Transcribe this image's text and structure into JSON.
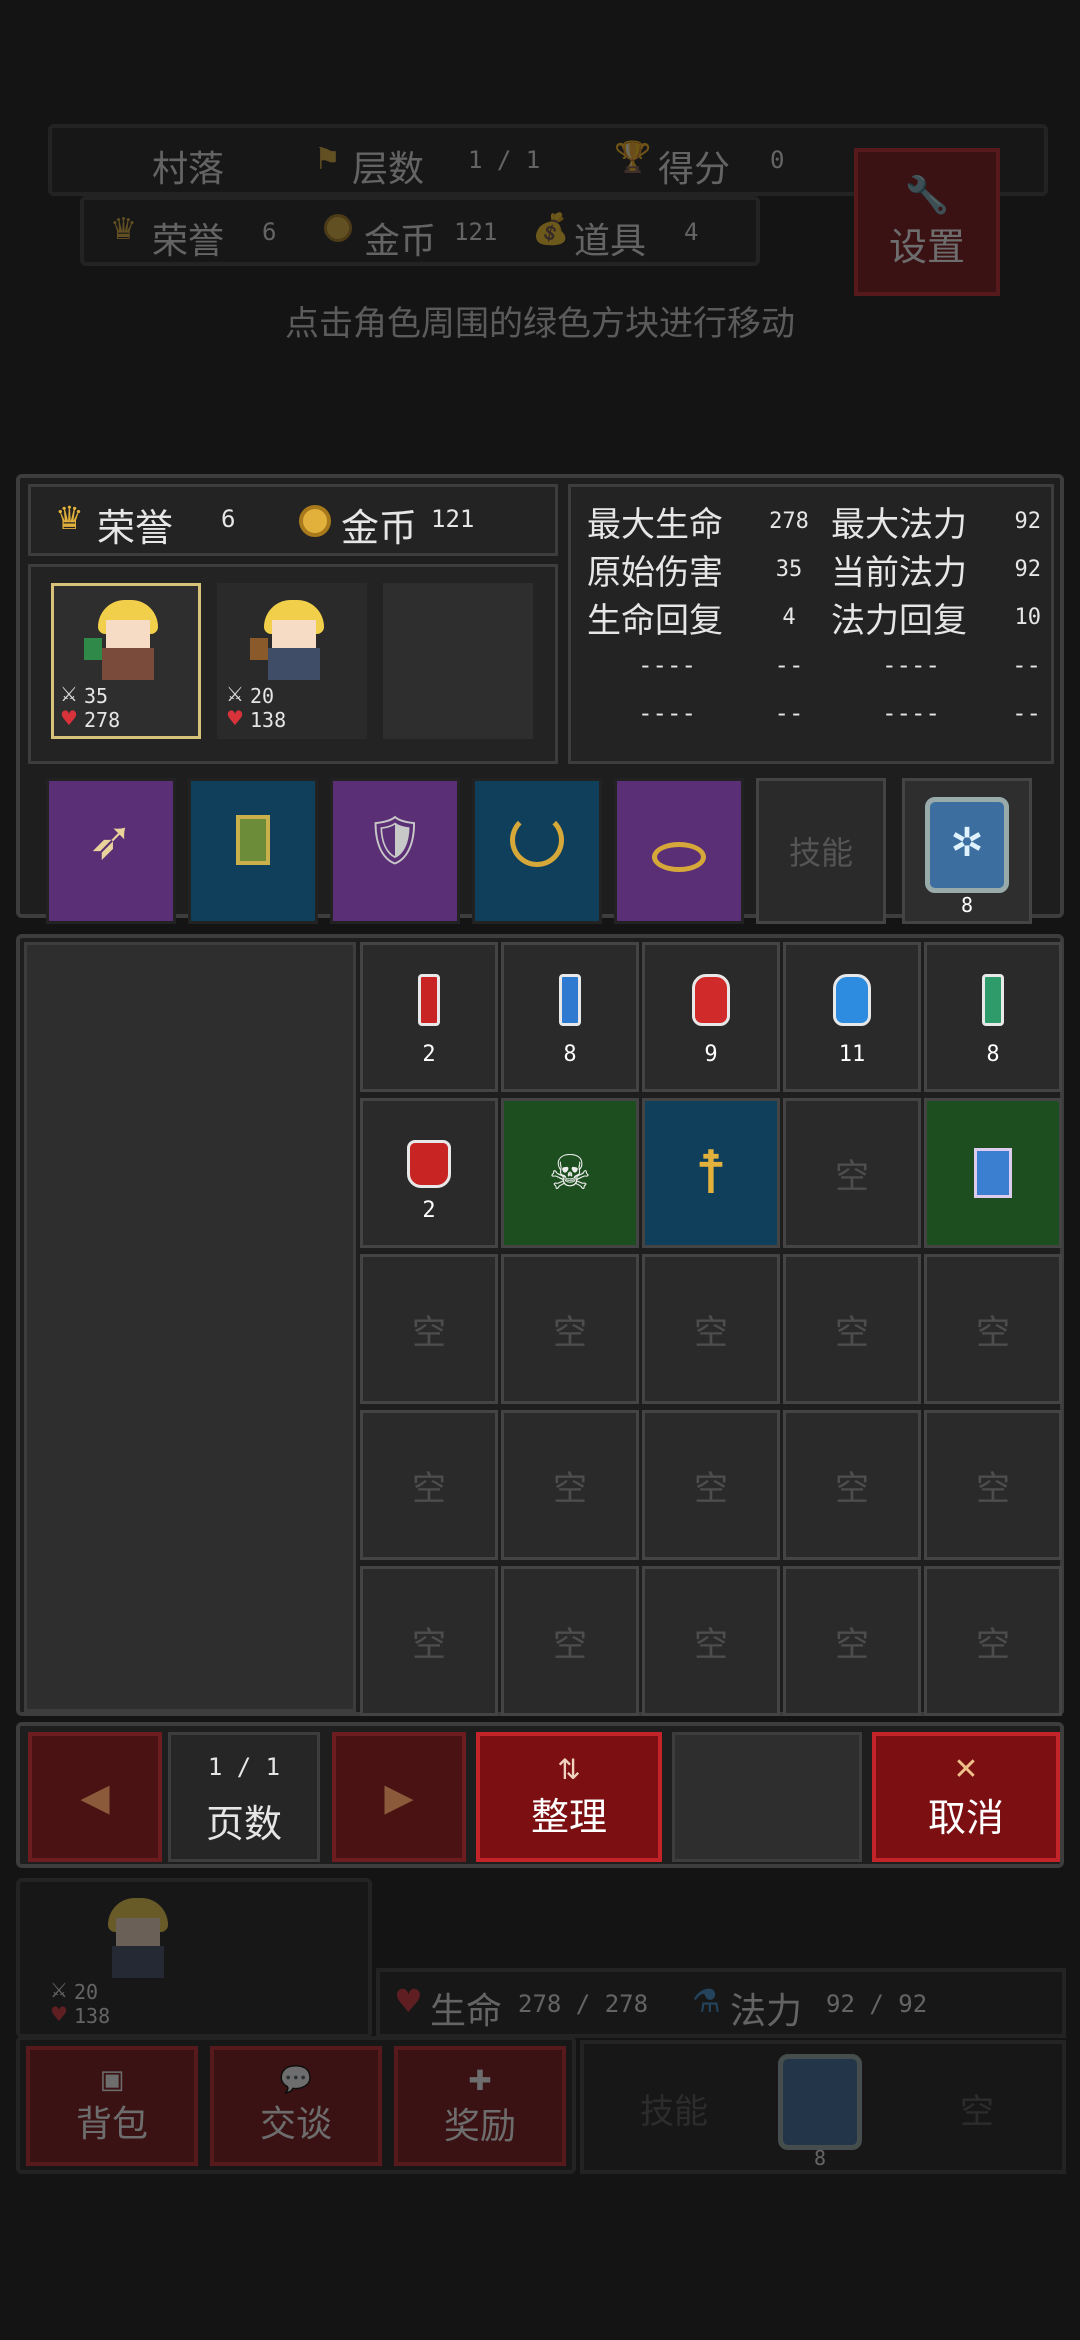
{
  "top": {
    "location": "村落",
    "floor_label": "层数",
    "floor_value": "1 / 1",
    "score_label": "得分",
    "score_value": "0",
    "honor_label": "荣誉",
    "honor_value": "6",
    "gold_label": "金币",
    "gold_value": "121",
    "items_label": "道具",
    "items_value": "4",
    "settings_label": "设置",
    "hint": "点击角色周围的绿色方块进行移动"
  },
  "panel": {
    "honor_label": "荣誉",
    "honor_value": "6",
    "gold_label": "金币",
    "gold_value": "121",
    "heroes": [
      {
        "atk": "35",
        "hp": "278",
        "selected": true
      },
      {
        "atk": "20",
        "hp": "138",
        "selected": false
      }
    ],
    "stats": {
      "max_hp_label": "最大生命",
      "max_hp": "278",
      "max_mp_label": "最大法力",
      "max_mp": "92",
      "base_dmg_label": "原始伤害",
      "base_dmg": "35",
      "cur_mp_label": "当前法力",
      "cur_mp": "92",
      "hp_regen_label": "生命回复",
      "hp_regen": "4",
      "mp_regen_label": "法力回复",
      "mp_regen": "10",
      "blank_long": "----",
      "blank_short": "--"
    },
    "skill_label": "技能",
    "skill_count": "8"
  },
  "inventory": {
    "row1": [
      "2",
      "8",
      "9",
      "11",
      "8"
    ],
    "potion_count": "2",
    "empty_label": "空"
  },
  "controls": {
    "page_value": "1 / 1",
    "page_label": "页数",
    "sort_label": "整理",
    "cancel_label": "取消"
  },
  "bottom": {
    "hero_atk": "20",
    "hero_hp": "138",
    "hp_label": "生命",
    "hp_value": "278 / 278",
    "mp_label": "法力",
    "mp_value": "92 / 92",
    "bag_label": "背包",
    "talk_label": "交谈",
    "reward_label": "奖励",
    "skill_label": "技能",
    "skill_count": "8",
    "empty_label": "空"
  },
  "colors": {
    "accent_red": "#c2242a",
    "gold": "#e2b13c",
    "heart": "#d8333a",
    "mana": "#3e8fd1"
  }
}
